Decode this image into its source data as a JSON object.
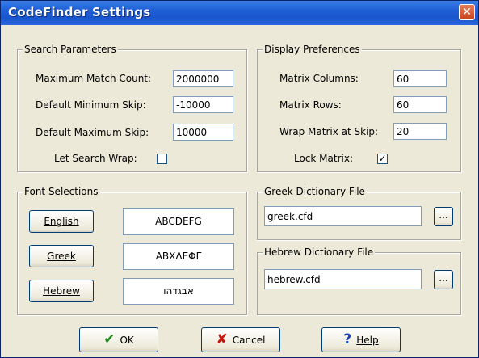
{
  "window": {
    "title": "CodeFinder Settings",
    "close_glyph": "✕"
  },
  "search": {
    "legend": "Search Parameters",
    "max_match_label": "Maximum Match Count:",
    "max_match_value": "2000000",
    "min_skip_label": "Default Minimum Skip:",
    "min_skip_value": "-10000",
    "max_skip_label": "Default Maximum Skip:",
    "max_skip_value": "10000",
    "wrap_label": "Let Search Wrap:",
    "wrap_checked": false
  },
  "display": {
    "legend": "Display Preferences",
    "columns_label": "Matrix Columns:",
    "columns_value": "60",
    "rows_label": "Matrix Rows:",
    "rows_value": "60",
    "wrap_label": "Wrap Matrix at Skip:",
    "wrap_value": "20",
    "lock_label": "Lock Matrix:",
    "lock_checked": true,
    "lock_glyph": "✓"
  },
  "fonts": {
    "legend": "Font Selections",
    "english_button": "English",
    "english_sample": "ABCDEFG",
    "greek_button": "Greek",
    "greek_sample": "ΑΒΧΔΕΦΓ",
    "hebrew_button": "Hebrew",
    "hebrew_sample": "אבגדהו"
  },
  "greek_dict": {
    "legend": "Greek Dictionary File",
    "value": "greek.cfd",
    "browse": "..."
  },
  "hebrew_dict": {
    "legend": "Hebrew Dictionary File",
    "value": "hebrew.cfd",
    "browse": "..."
  },
  "buttons": {
    "ok_label": "OK",
    "ok_icon": "✔",
    "cancel_label": "Cancel",
    "cancel_icon": "✘",
    "help_label": "Help",
    "help_icon": "?"
  }
}
